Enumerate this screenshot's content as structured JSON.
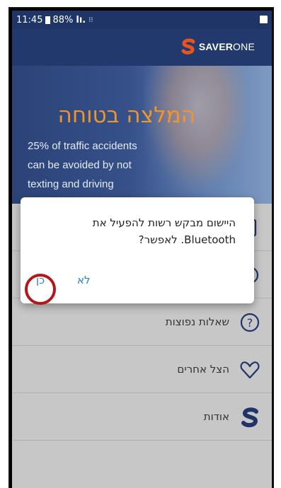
{
  "statusbar": {
    "time": "11:45",
    "battery": "88%",
    "signal": "lı.",
    "extra": "⁝⁝"
  },
  "header": {
    "logo_bold": "SAVER",
    "logo_light": "ONE",
    "logo_color": "#e8541d"
  },
  "hero": {
    "title": "המלצה בטוחה",
    "text_lines": [
      "25% of traffic accidents",
      "can be avoided by not",
      "texting and driving"
    ],
    "title_color": "#f0952c"
  },
  "list": {
    "items": [
      {
        "label": "",
        "icon": "document-icon"
      },
      {
        "label": "",
        "icon": "settings-icon"
      },
      {
        "label": "שאלות נפוצות",
        "icon": "question-icon"
      },
      {
        "label": "הצל אחרים",
        "icon": "heart-icon"
      },
      {
        "label": "אודות",
        "icon": "saverone-s-icon"
      }
    ]
  },
  "dialog": {
    "message": "היישום מבקש רשות להפעיל את Bluetooth. לאפשר?",
    "no_label": "לא",
    "yes_label": "כן",
    "button_color": "#2b7fc4"
  },
  "annotation": {
    "circle_color": "#b4161b"
  }
}
